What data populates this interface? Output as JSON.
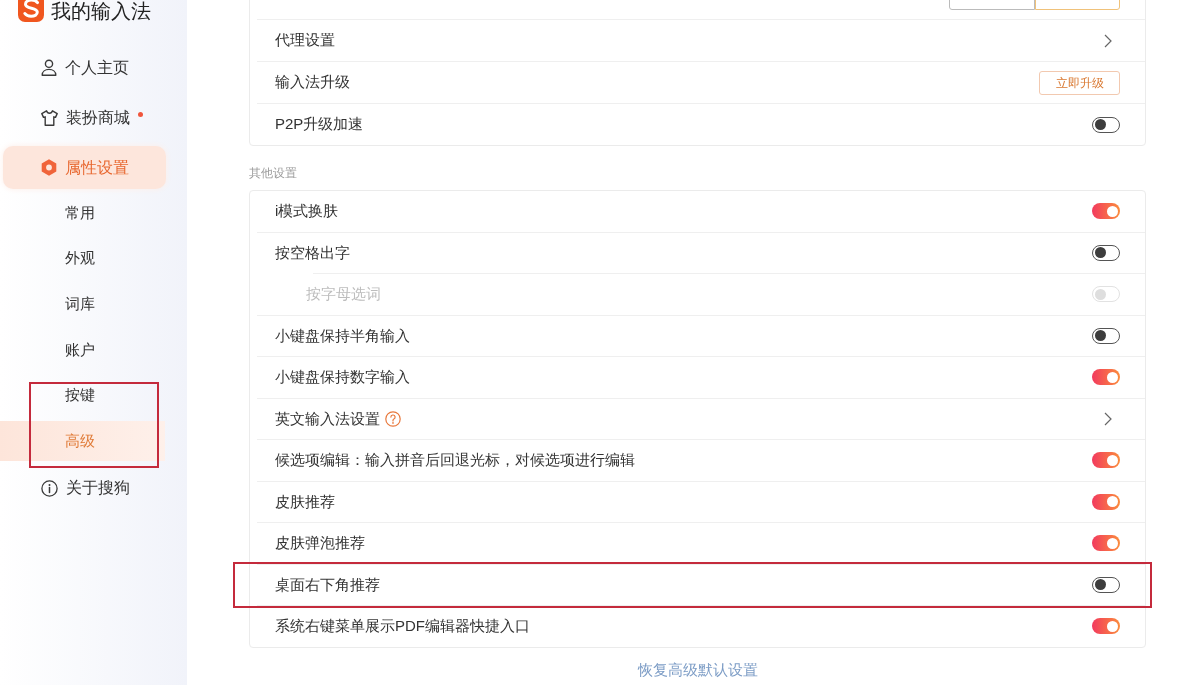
{
  "sidebar": {
    "title": "我的输入法",
    "items": [
      {
        "label": "个人主页",
        "selected": false
      },
      {
        "label": "装扮商城",
        "selected": false,
        "notification": true
      },
      {
        "label": "属性设置",
        "selected": true,
        "children": [
          {
            "label": "常用",
            "selected": false
          },
          {
            "label": "外观",
            "selected": false
          },
          {
            "label": "词库",
            "selected": false
          },
          {
            "label": "账户",
            "selected": false
          },
          {
            "label": "按键",
            "selected": false
          },
          {
            "label": "高级",
            "selected": true,
            "annotated": true
          }
        ]
      },
      {
        "label": "关于搜狗",
        "selected": false
      }
    ]
  },
  "sections": [
    {
      "rows": [
        {
          "kind": "segmented",
          "segments": [
            {
              "selected": false
            },
            {
              "selected": true
            }
          ]
        },
        {
          "kind": "link",
          "label": "代理设置"
        },
        {
          "kind": "button",
          "label": "输入法升级",
          "button": "立即升级"
        },
        {
          "kind": "toggle",
          "label": "P2P升级加速",
          "on": false,
          "disabled": false
        }
      ]
    },
    {
      "title": "其他设置",
      "rows": [
        {
          "kind": "toggle",
          "label": "i模式换肤",
          "on": true,
          "disabled": false
        },
        {
          "kind": "toggle",
          "label": "按空格出字",
          "on": false,
          "disabled": false,
          "children": [
            {
              "kind": "toggle",
              "label": "按字母选词",
              "on": false,
              "disabled": true
            }
          ]
        },
        {
          "kind": "toggle",
          "label": "小键盘保持半角输入",
          "on": false,
          "disabled": false
        },
        {
          "kind": "toggle",
          "label": "小键盘保持数字输入",
          "on": true,
          "disabled": false
        },
        {
          "kind": "link",
          "label": "英文输入法设置",
          "help": true
        },
        {
          "kind": "toggle",
          "label": "候选项编辑：输入拼音后回退光标，对候选项进行编辑",
          "on": true,
          "disabled": false
        },
        {
          "kind": "toggle",
          "label": "皮肤推荐",
          "on": true,
          "disabled": false
        },
        {
          "kind": "toggle",
          "label": "皮肤弹泡推荐",
          "on": true,
          "disabled": false
        },
        {
          "kind": "toggle",
          "label": "桌面右下角推荐",
          "on": false,
          "disabled": false,
          "annotated": true
        },
        {
          "kind": "toggle",
          "label": "系统右键菜单展示PDF编辑器快捷入口",
          "on": true,
          "disabled": false
        }
      ]
    }
  ],
  "reset_link": "恢复高级默认设置"
}
